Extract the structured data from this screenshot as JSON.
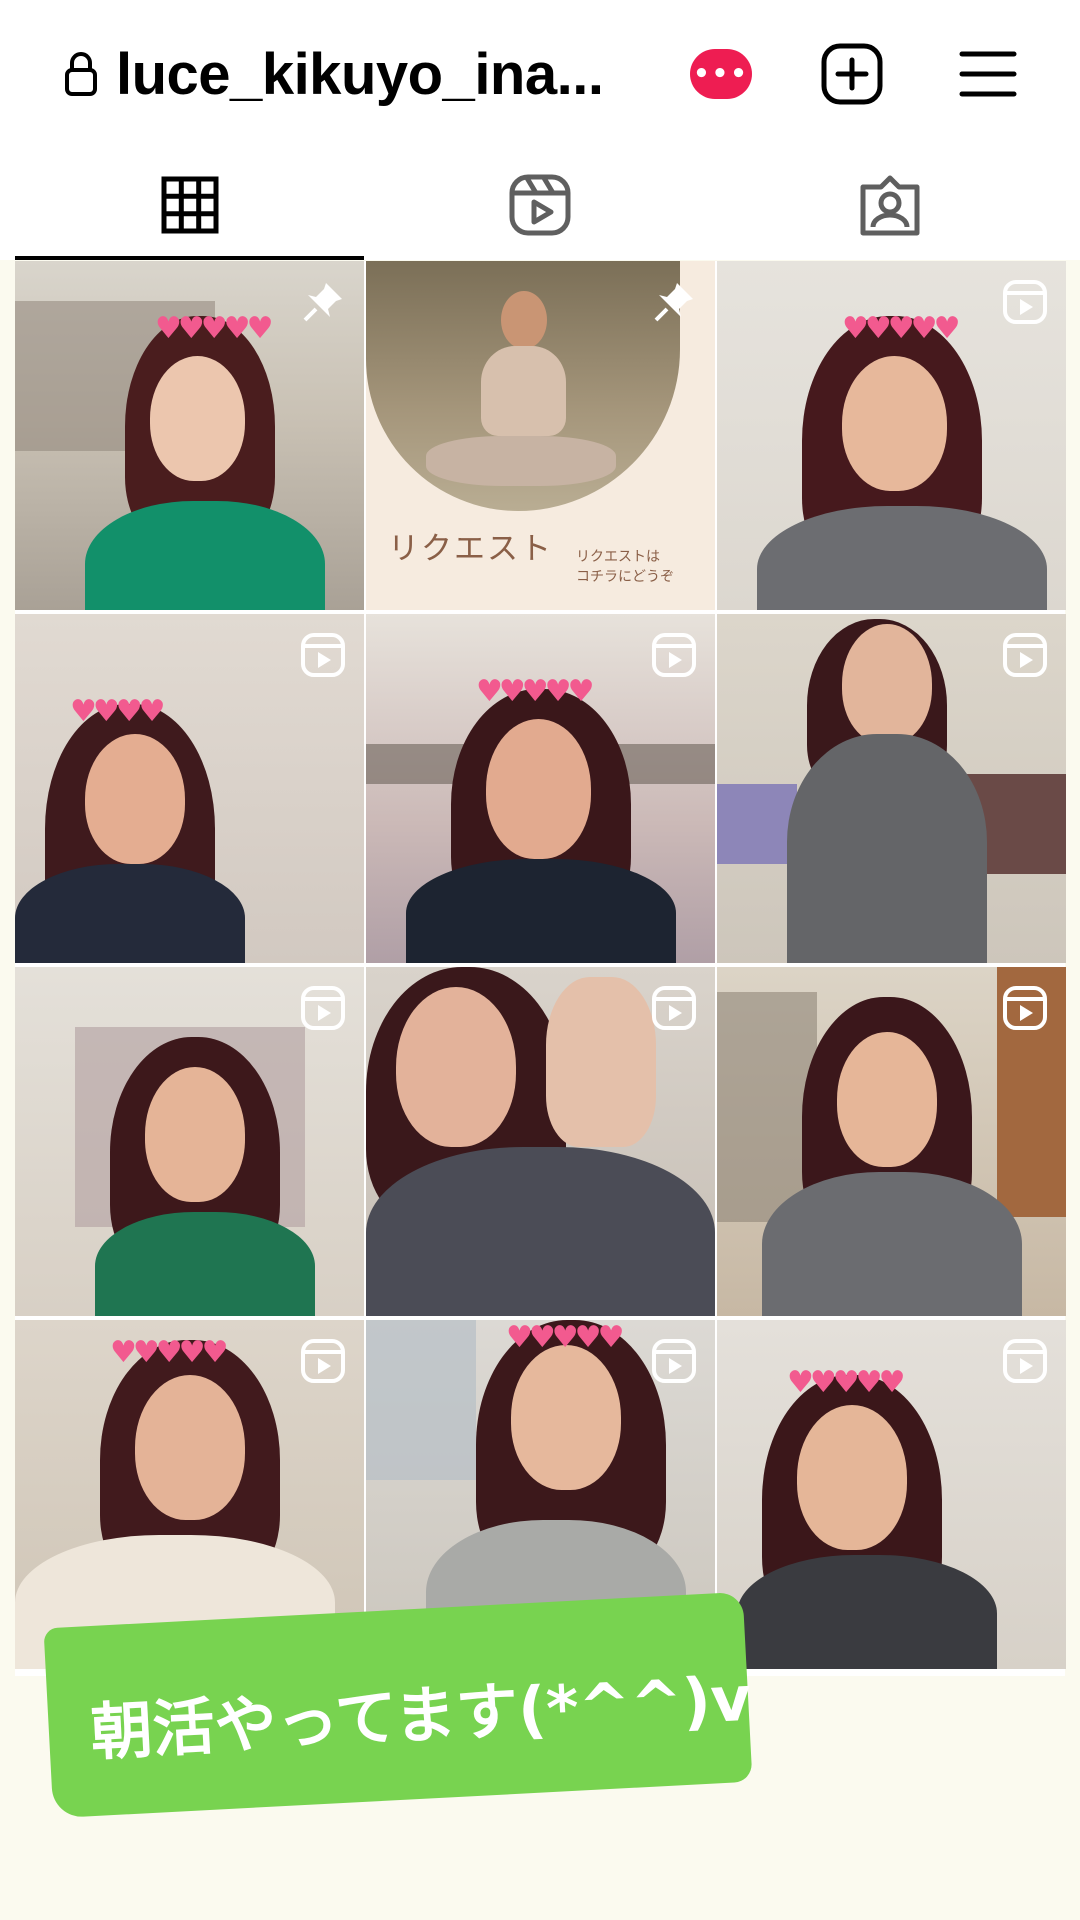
{
  "header": {
    "username": "luce_kikuyo_ina...",
    "badge_text": "•••",
    "badge_color": "#ee1d52",
    "icons": [
      "lock-icon",
      "new-post-icon",
      "menu-icon"
    ]
  },
  "tabs": [
    {
      "name": "posts-grid",
      "icon": "grid-icon",
      "active": true
    },
    {
      "name": "reels",
      "icon": "reels-icon",
      "active": false
    },
    {
      "name": "tagged",
      "icon": "tagged-icon",
      "active": false
    }
  ],
  "posts": {
    "pinned_icon": "pin-icon",
    "reel_icon": "reel-icon",
    "request_post": {
      "title": "リクエスト",
      "subtitle_line1": "リクエストは",
      "subtitle_line2": "コチラにどうぞ"
    }
  },
  "caption": {
    "text": "朝活やってます(*^^)v",
    "color": "#78d350"
  }
}
